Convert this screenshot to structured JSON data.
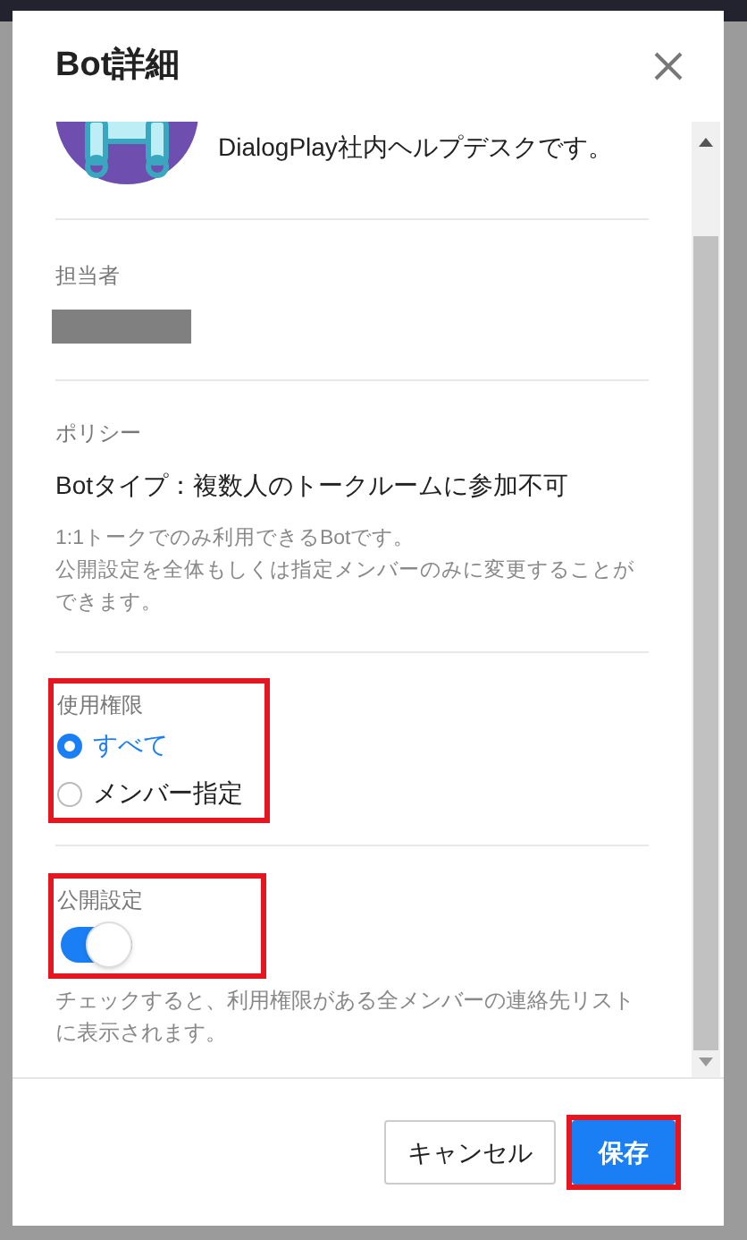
{
  "dialog": {
    "title": "Bot詳細",
    "description": "DialogPlay社内ヘルプデスクです。",
    "owner": {
      "label": "担当者",
      "redacted": true
    },
    "policy": {
      "label": "ポリシー",
      "type": "Botタイプ：複数人のトークルームに参加不可",
      "note_lines": [
        "1:1トークでのみ利用できるBotです。",
        "公開設定を全体もしくは指定メンバーのみに変更することができます。"
      ]
    },
    "permission": {
      "label": "使用権限",
      "highlighted": true,
      "options": [
        {
          "label": "すべて",
          "selected": true
        },
        {
          "label": "メンバー指定",
          "selected": false
        }
      ]
    },
    "publish": {
      "label": "公開設定",
      "highlighted": true,
      "on": true,
      "note": "チェックすると、利用権限がある全メンバーの連絡先リストに表示されます。"
    },
    "buttons": [
      {
        "label": "キャンセル",
        "kind": "secondary",
        "highlighted": false
      },
      {
        "label": "保存",
        "kind": "primary",
        "highlighted": true
      }
    ]
  }
}
